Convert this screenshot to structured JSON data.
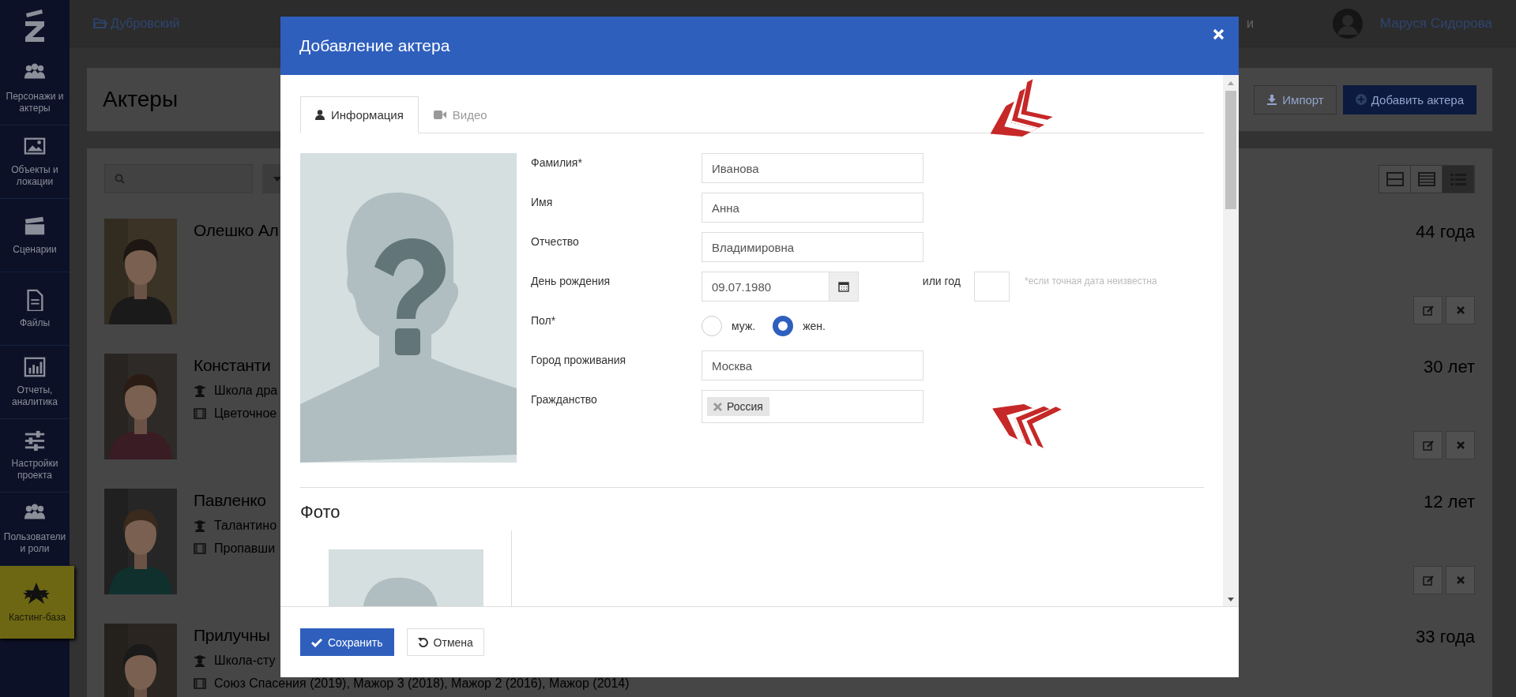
{
  "sidebar": {
    "items": [
      {
        "label": "Персонажи и актеры",
        "selected": false
      },
      {
        "label": "Объекты и локации",
        "selected": false
      },
      {
        "label": "Сценарии",
        "selected": false
      },
      {
        "label": "Файлы",
        "selected": false
      },
      {
        "label": "Отчеты, аналитика",
        "selected": false
      },
      {
        "label": "Настройки проекта",
        "selected": false
      },
      {
        "label": "Пользователи и роли",
        "selected": false
      },
      {
        "label": "Кастинг-база",
        "selected": true
      }
    ]
  },
  "topbar": {
    "project": "Дубровский",
    "nav_fragment": "и",
    "user": "Маруся Сидорова"
  },
  "page": {
    "title": "Актеры",
    "buttons": [
      {
        "label": "Импорт",
        "kind": "import"
      },
      {
        "label": "Добавить актера",
        "kind": "add"
      }
    ]
  },
  "view_modes": [
    {
      "selected": false
    },
    {
      "selected": false
    },
    {
      "selected": true
    }
  ],
  "actors": [
    {
      "name": "Олешко Ал",
      "age": "44 года"
    },
    {
      "name": "Константи",
      "age": "30 лет",
      "lines": [
        {
          "kind": "school",
          "text": "Школа дра"
        },
        {
          "kind": "film",
          "text": "Цветочное"
        }
      ]
    },
    {
      "name": "Павленко",
      "age": "12 лет",
      "lines": [
        {
          "kind": "school",
          "text": "Талантино"
        },
        {
          "kind": "film",
          "text": "Пропавши"
        }
      ]
    },
    {
      "name": "Прилучны",
      "age": "33 года",
      "lines": [
        {
          "kind": "school",
          "text": "Школа-сту"
        },
        {
          "kind": "film",
          "text": "Союз Спасения (2019), Мажор 3 (2018), Мажор 2 (2016), Мажор (2014)"
        }
      ]
    }
  ],
  "modal": {
    "title": "Добавление актера",
    "tabs": [
      {
        "label": "Информация",
        "kind": "person",
        "selected": true
      },
      {
        "label": "Видео",
        "kind": "video",
        "selected": false
      }
    ],
    "fields": [
      {
        "kind": "text",
        "label": "Фамилия*",
        "value": "Иванова"
      },
      {
        "kind": "text",
        "label": "Имя",
        "value": "Анна"
      },
      {
        "kind": "text",
        "label": "Отчество",
        "value": "Владимировна"
      },
      {
        "kind": "date",
        "label": "День рождения",
        "value": "09.07.1980",
        "year_label": "или год",
        "hint": "*если точная дата неизвестна"
      },
      {
        "kind": "radio",
        "label": "Пол*",
        "options": [
          {
            "label": "муж.",
            "selected": false
          },
          {
            "label": "жен.",
            "selected": true
          }
        ]
      },
      {
        "kind": "text",
        "label": "Город проживания",
        "value": "Москва"
      },
      {
        "kind": "tags",
        "label": "Гражданство",
        "tags": [
          "Россия"
        ]
      }
    ],
    "photo_section": {
      "title": "Фото"
    },
    "buttons": [
      {
        "label": "Сохранить",
        "kind": "primary"
      },
      {
        "label": "Отмена",
        "kind": "cancel"
      }
    ]
  }
}
